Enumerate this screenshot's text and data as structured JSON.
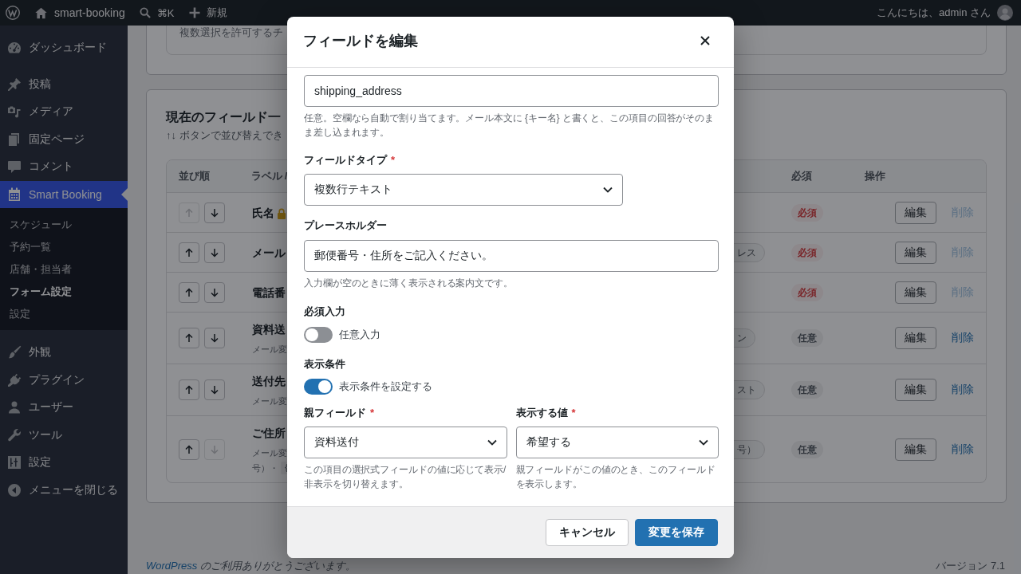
{
  "admin_bar": {
    "site_name": "smart-booking",
    "search_shortcut": "⌘K",
    "new_label": "新規",
    "greeting": "こんにちは、admin さん"
  },
  "sidebar": {
    "groups": [
      {
        "items": [
          {
            "label": "ダッシュボード",
            "selected": false
          }
        ]
      },
      {
        "items": [
          {
            "label": "投稿",
            "selected": false
          },
          {
            "label": "メディア",
            "selected": false
          },
          {
            "label": "固定ページ",
            "selected": false
          },
          {
            "label": "コメント",
            "selected": false
          },
          {
            "label": "Smart Booking",
            "selected": true,
            "submenu": [
              {
                "label": "スケジュール",
                "selected": false
              },
              {
                "label": "予約一覧",
                "selected": false
              },
              {
                "label": "店舗・担当者",
                "selected": false
              },
              {
                "label": "フォーム設定",
                "selected": true
              },
              {
                "label": "設定",
                "selected": false
              }
            ]
          }
        ]
      },
      {
        "items": [
          {
            "label": "外観",
            "selected": false
          },
          {
            "label": "プラグイン",
            "selected": false
          },
          {
            "label": "ユーザー",
            "selected": false
          },
          {
            "label": "ツール",
            "selected": false
          },
          {
            "label": "設定",
            "selected": false
          },
          {
            "label": "メニューを閉じる",
            "selected": false
          }
        ]
      }
    ]
  },
  "top_card": {
    "option_text": "複数選択を許可するチ"
  },
  "fields_card": {
    "title": "現在のフィールド一",
    "description": "↑↓ ボタンで並び替えでき",
    "table": {
      "columns": [
        "並び順",
        "ラベル /",
        "必須",
        "操作"
      ],
      "rows": [
        {
          "label": "氏名",
          "locked": true,
          "required": true,
          "badge": "必須",
          "edit": "編集",
          "delete": "削除",
          "delete_disabled": true,
          "up_disabled": true,
          "down_disabled": false
        },
        {
          "label": "メール",
          "locked": false,
          "type": "レス",
          "required": true,
          "badge": "必須",
          "edit": "編集",
          "delete": "削除",
          "delete_disabled": true,
          "up_disabled": false,
          "down_disabled": false
        },
        {
          "label": "電話番",
          "locked": false,
          "required": true,
          "badge": "必須",
          "edit": "編集",
          "delete": "削除",
          "delete_disabled": true,
          "up_disabled": false,
          "down_disabled": false
        },
        {
          "label": "資料送",
          "locked": false,
          "notes": [
            {
              "text": "メール変"
            }
          ],
          "type": "ン",
          "required": false,
          "badge": "任意",
          "edit": "編集",
          "delete": "削除",
          "delete_disabled": false,
          "up_disabled": false,
          "down_disabled": false
        },
        {
          "label": "送付先",
          "locked": false,
          "notes": [
            {
              "text": "メール変"
            }
          ],
          "type": "スト",
          "required": false,
          "badge": "任意",
          "edit": "編集",
          "delete": "削除",
          "delete_disabled": false,
          "up_disabled": false,
          "down_disabled": false
        },
        {
          "label": "ご住所",
          "locked": false,
          "notes": [
            {
              "text": "メール変"
            },
            {
              "text": "号）・",
              "code": "{"
            }
          ],
          "type": "号）",
          "required": false,
          "badge": "任意",
          "edit": "編集",
          "delete": "削除",
          "delete_disabled": false,
          "up_disabled": false,
          "down_disabled": true
        }
      ]
    }
  },
  "footer": {
    "link": "WordPress",
    "thanks": "のご利用ありがとうございます。",
    "version": "バージョン 7.1"
  },
  "modal": {
    "title": "フィールドを編集",
    "key_input": {
      "value": "shipping_address",
      "help": "任意。空欄なら自動で割り当てます。メール本文に {キー名} と書くと、この項目の回答がそのまま差し込まれます。"
    },
    "field_type": {
      "label": "フィールドタイプ",
      "required_mark": "*",
      "value": "複数行テキスト"
    },
    "placeholder_input": {
      "label": "プレースホルダー",
      "value": "郵便番号・住所をご記入ください。",
      "help": "入力欄が空のときに薄く表示される案内文です。"
    },
    "required_toggle": {
      "label": "必須入力",
      "on": false,
      "text": "任意入力"
    },
    "condition_toggle": {
      "label": "表示条件",
      "on": true,
      "text": "表示条件を設定する"
    },
    "condition_fields": [
      {
        "label": "親フィールド",
        "required_mark": "*",
        "value": "資料送付",
        "help": "この項目の選択式フィールドの値に応じて表示/非表示を切り替えます。"
      },
      {
        "label": "表示する値",
        "required_mark": "*",
        "value": "希望する",
        "help": "親フィールドがこの値のとき、このフィールドを表示します。"
      }
    ],
    "buttons": [
      {
        "label": "キャンセル",
        "kind": "secondary"
      },
      {
        "label": "変更を保存",
        "kind": "primary"
      }
    ]
  }
}
